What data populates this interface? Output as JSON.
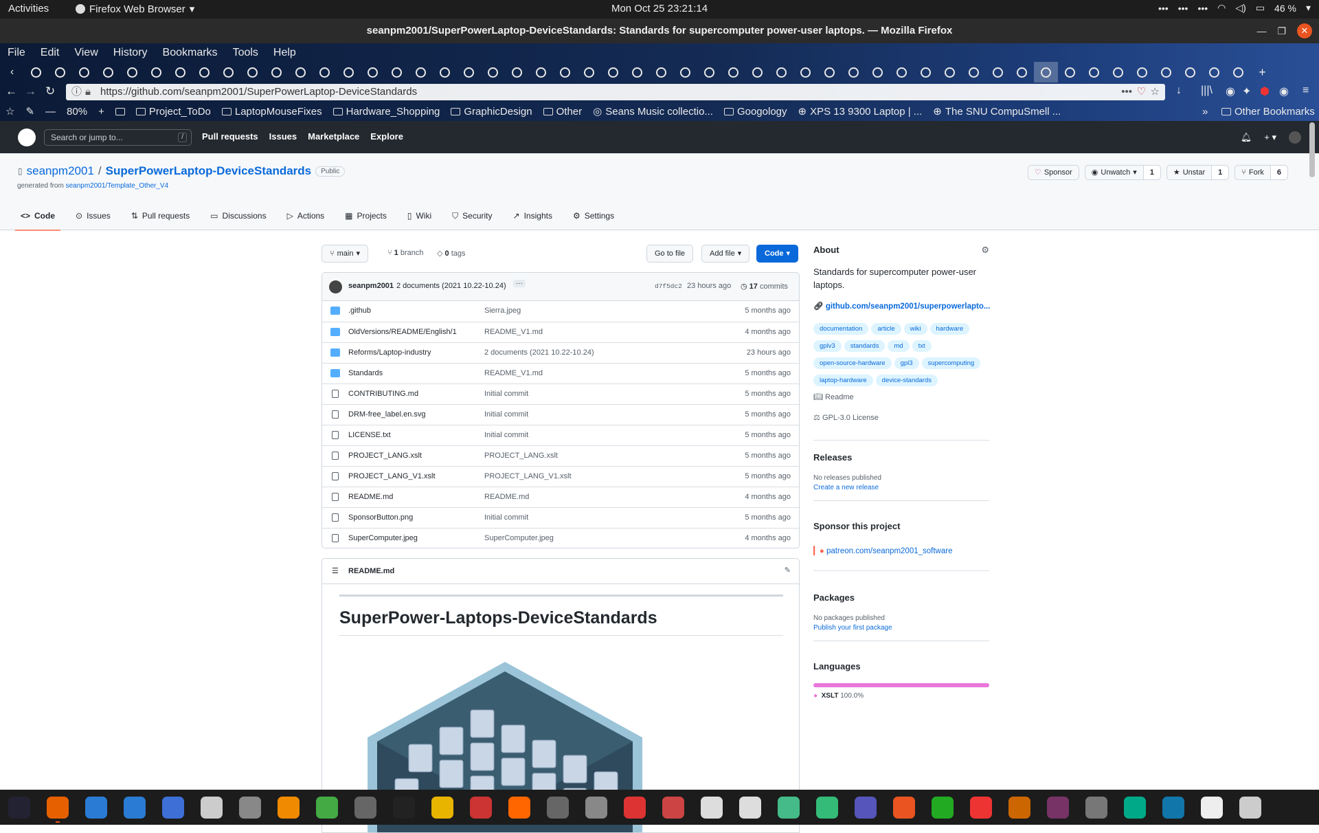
{
  "gnome": {
    "activities": "Activities",
    "app_menu": "Firefox Web Browser",
    "clock": "Mon Oct 25  23:21:14",
    "battery": "46 %"
  },
  "window": {
    "title": "seanpm2001/SuperPowerLaptop-DeviceStandards: Standards for supercomputer power-user laptops. — Mozilla Firefox"
  },
  "firefox": {
    "menu": [
      "File",
      "Edit",
      "View",
      "History",
      "Bookmarks",
      "Tools",
      "Help"
    ],
    "url": "https://github.com/seanpm2001/SuperPowerLaptop-DeviceStandards",
    "zoom": "80%",
    "bookmarks": [
      "Project_ToDo",
      "LaptopMouseFixes",
      "Hardware_Shopping",
      "GraphicDesign",
      "Other",
      "Seans Music collectio...",
      "Googology",
      "XPS 13 9300 Laptop | ...",
      "The SNU CompuSmell ..."
    ],
    "other_bookmarks": "Other Bookmarks"
  },
  "github": {
    "search_placeholder": "Search or jump to...",
    "search_key": "/",
    "nav": [
      "Pull requests",
      "Issues",
      "Marketplace",
      "Explore"
    ]
  },
  "repo": {
    "owner": "seanpm2001",
    "name": "SuperPowerLaptop-DeviceStandards",
    "visibility": "Public",
    "generated_prefix": "generated from ",
    "generated_from": "seanpm2001/Template_Other_V4",
    "sponsor": "Sponsor",
    "unwatch": "Unwatch",
    "watch_count": "1",
    "unstar": "Unstar",
    "star_count": "1",
    "fork": "Fork",
    "fork_count": "6",
    "tabs": [
      "Code",
      "Issues",
      "Pull requests",
      "Discussions",
      "Actions",
      "Projects",
      "Wiki",
      "Security",
      "Insights",
      "Settings"
    ]
  },
  "code": {
    "branch": "main",
    "branch_count": "1",
    "branch_label": "branch",
    "tag_count": "0",
    "tag_label": "tags",
    "goto_file": "Go to file",
    "add_file": "Add file",
    "code_button": "Code",
    "commit_author": "seanpm2001",
    "commit_message": "2 documents (2021 10.22-10.24)",
    "commit_hash": "d7f5dc2",
    "commit_age": "23 hours ago",
    "commits_count": "17",
    "commits_label": "commits",
    "files": [
      {
        "name": ".github",
        "msg": "Sierra.jpeg",
        "age": "5 months ago",
        "type": "dir"
      },
      {
        "name": "OldVersions/README/English/1",
        "msg": "README_V1.md",
        "age": "4 months ago",
        "type": "dir"
      },
      {
        "name": "Reforms/Laptop-industry",
        "msg": "2 documents (2021 10.22-10.24)",
        "age": "23 hours ago",
        "type": "dir"
      },
      {
        "name": "Standards",
        "msg": "README_V1.md",
        "age": "5 months ago",
        "type": "dir"
      },
      {
        "name": "CONTRIBUTING.md",
        "msg": "Initial commit",
        "age": "5 months ago",
        "type": "file"
      },
      {
        "name": "DRM-free_label.en.svg",
        "msg": "Initial commit",
        "age": "5 months ago",
        "type": "file"
      },
      {
        "name": "LICENSE.txt",
        "msg": "Initial commit",
        "age": "5 months ago",
        "type": "file"
      },
      {
        "name": "PROJECT_LANG.xslt",
        "msg": "PROJECT_LANG.xslt",
        "age": "5 months ago",
        "type": "file"
      },
      {
        "name": "PROJECT_LANG_V1.xslt",
        "msg": "PROJECT_LANG_V1.xslt",
        "age": "5 months ago",
        "type": "file"
      },
      {
        "name": "README.md",
        "msg": "README.md",
        "age": "4 months ago",
        "type": "file"
      },
      {
        "name": "SponsorButton.png",
        "msg": "Initial commit",
        "age": "5 months ago",
        "type": "file"
      },
      {
        "name": "SuperComputer.jpeg",
        "msg": "SuperComputer.jpeg",
        "age": "4 months ago",
        "type": "file"
      }
    ],
    "readme_file": "README.md",
    "readme_title": "SuperPower-Laptops-DeviceStandards"
  },
  "about": {
    "heading": "About",
    "description": "Standards for supercomputer power-user laptops.",
    "website": "github.com/seanpm2001/superpowerlapto...",
    "topics": [
      "documentation",
      "article",
      "wiki",
      "hardware",
      "gplv3",
      "standards",
      "md",
      "txt",
      "open-source-hardware",
      "gpl3",
      "supercomputing",
      "laptop-hardware",
      "device-standards"
    ],
    "readme": "Readme",
    "license": "GPL-3.0 License",
    "releases_heading": "Releases",
    "releases_none": "No releases published",
    "releases_create": "Create a new release",
    "sponsor_heading": "Sponsor this project",
    "sponsor_link": "patreon.com/seanpm2001_software",
    "packages_heading": "Packages",
    "packages_none": "No packages published",
    "packages_publish": "Publish your first package",
    "languages_heading": "Languages",
    "language": "XSLT",
    "language_pct": "100.0%",
    "language_color": "#ea77da"
  }
}
